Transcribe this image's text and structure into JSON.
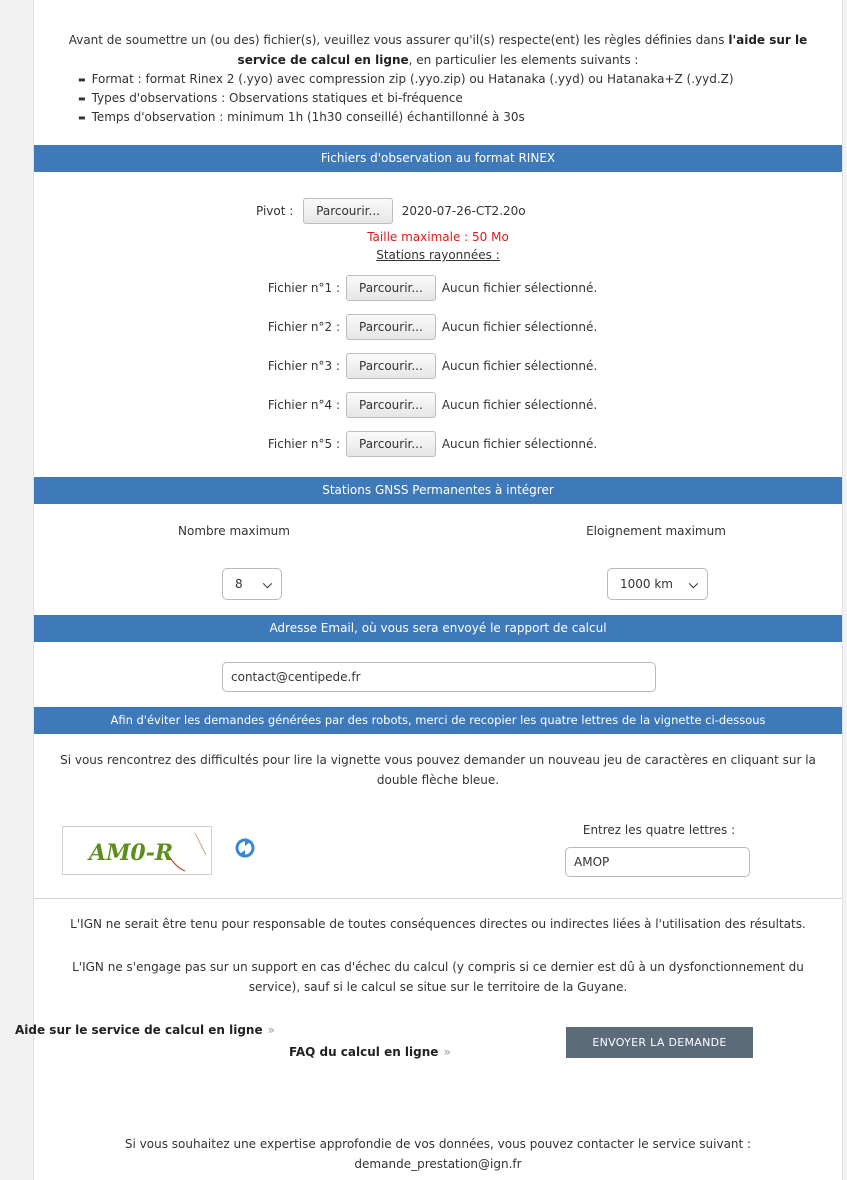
{
  "intro": {
    "text_before": "Avant de soumettre un (ou des) fichier(s), veuillez vous assurer qu'il(s) respecte(ent) les règles définies dans ",
    "help_link": "l'aide sur le service de calcul en ligne",
    "text_after": ", en particulier les elements suivants :",
    "rules": [
      "Format : format Rinex 2 (.yyo) avec compression zip (.yyo.zip) ou Hatanaka (.yyd) ou Hatanaka+Z (.yyd.Z)",
      "Types d'observations : Observations statiques et bi-fréquence",
      "Temps d'observation : minimum 1h (1h30 conseillé) échantillonné à 30s"
    ]
  },
  "rinex": {
    "header": "Fichiers d'observation au format RINEX",
    "pivot_label": "Pivot :",
    "browse_label": "Parcourir...",
    "pivot_file": "2020-07-26-CT2.20o",
    "max_size": "Taille maximale : 50 Mo",
    "stations_title": "Stations rayonnées :",
    "files": [
      {
        "label": "Fichier n°1 :",
        "status": "Aucun fichier sélectionné."
      },
      {
        "label": "Fichier n°2 :",
        "status": "Aucun fichier sélectionné."
      },
      {
        "label": "Fichier n°3 :",
        "status": "Aucun fichier sélectionné."
      },
      {
        "label": "Fichier n°4 :",
        "status": "Aucun fichier sélectionné."
      },
      {
        "label": "Fichier n°5 :",
        "status": "Aucun fichier sélectionné."
      }
    ]
  },
  "gnss": {
    "header": "Stations GNSS Permanentes à intégrer",
    "count_label": "Nombre maximum",
    "count_value": "8",
    "distance_label": "Eloignement maximum",
    "distance_value": "1000 km"
  },
  "email": {
    "header": "Adresse Email, où vous sera envoyé le rapport de calcul",
    "value": "contact@centipede.fr"
  },
  "captcha": {
    "header": "Afin d'éviter les demandes générées par des robots, merci de recopier les quatre lettres de la vignette ci-dessous",
    "help": "Si vous rencontrez des difficultés pour lire la vignette vous pouvez demander un nouveau jeu de caractères en cliquant sur la double flèche bleue.",
    "image_text": "AM0-R",
    "input_label": "Entrez les quatre lettres :",
    "input_value": "AMOP"
  },
  "disclaimer": {
    "line1": "L'IGN ne serait être tenu pour responsable de toutes conséquences directes ou indirectes liées à l'utilisation des résultats.",
    "line2": "L'IGN ne s'engage pas sur un support en cas d'échec du calcul (y compris si ce dernier est dû à un dysfonctionnement du service), sauf si le calcul se situe sur le territoire de la Guyane."
  },
  "links": {
    "help": "Aide sur le service de calcul en ligne",
    "faq": "FAQ du calcul en ligne",
    "arrow": "»"
  },
  "submit_label": "ENVOYER LA DEMANDE",
  "footer": {
    "text": "Si vous souhaitez une expertise approfondie de vos données, vous pouvez contacter le service suivant :",
    "email": "demande_prestation@ign.fr"
  },
  "colors": {
    "section_bar": "#3e7ab9",
    "error_text": "#e0191b",
    "submit_bg": "#5c6b7a",
    "refresh_icon": "#3b86d4"
  }
}
